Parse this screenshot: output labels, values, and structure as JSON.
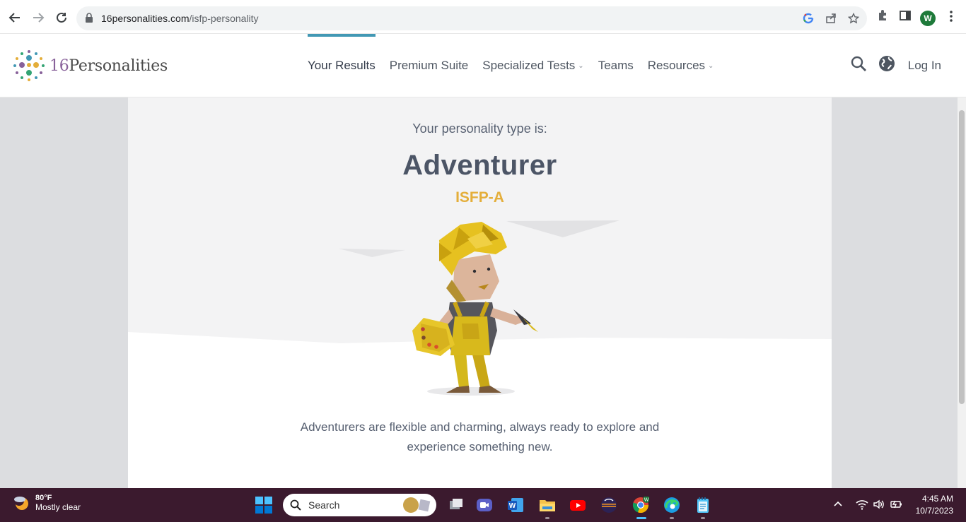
{
  "browser": {
    "url_domain": "16personalities.com",
    "url_path": "/isfp-personality",
    "avatar_letter": "W"
  },
  "header": {
    "logo_number": "16",
    "logo_word": "Personalities",
    "nav": [
      {
        "label": "Your Results"
      },
      {
        "label": "Premium Suite"
      },
      {
        "label": "Specialized Tests"
      },
      {
        "label": "Teams"
      },
      {
        "label": "Resources"
      }
    ],
    "login_label": "Log In"
  },
  "result": {
    "intro": "Your personality type is:",
    "type_name": "Adventurer",
    "type_code": "ISFP-A",
    "description": "Adventurers are flexible and charming, always ready to explore and experience something new."
  },
  "taskbar": {
    "weather_temp": "80°F",
    "weather_desc": "Mostly clear",
    "search_label": "Search",
    "time": "4:45 AM",
    "date": "10/7/2023"
  },
  "colors": {
    "accent_nav": "#4298b4",
    "type_code": "#e4ae3a",
    "taskbar": "#3b1a2e"
  }
}
